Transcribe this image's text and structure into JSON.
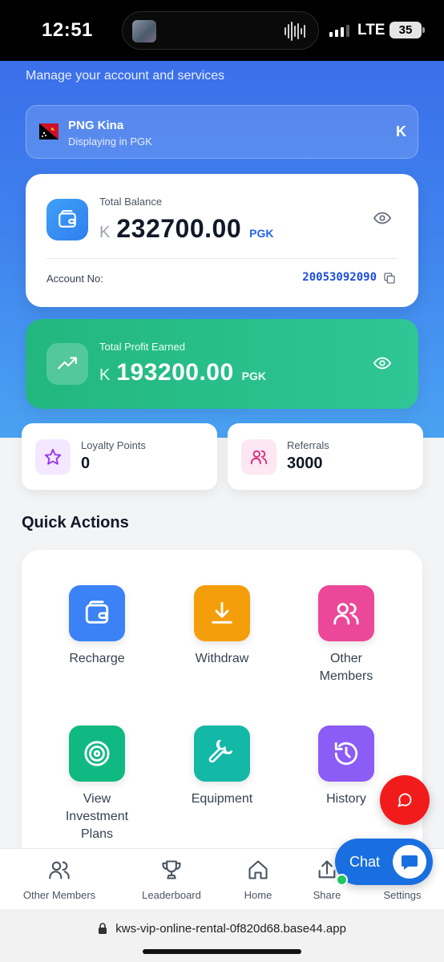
{
  "status": {
    "time": "12:51",
    "network": "LTE",
    "battery": "35"
  },
  "header": {
    "subtitle": "Manage your account and services"
  },
  "currency": {
    "name": "PNG Kina",
    "sub": "Displaying in PGK",
    "symbol": "K"
  },
  "balance": {
    "label": "Total Balance",
    "symbol": "K",
    "amount": "232700.00",
    "currency": "PGK",
    "account_label": "Account No:",
    "account_no": "20053092090"
  },
  "profit": {
    "label": "Total Profit Earned",
    "symbol": "K",
    "amount": "193200.00",
    "currency": "PGK"
  },
  "stats": {
    "loyalty": {
      "label": "Loyalty Points",
      "value": "0"
    },
    "referrals": {
      "label": "Referrals",
      "value": "3000"
    }
  },
  "quick_actions": {
    "title": "Quick Actions",
    "items": [
      {
        "label": "Recharge",
        "icon": "wallet-icon",
        "color": "#3b82f6"
      },
      {
        "label": "Withdraw",
        "icon": "download-icon",
        "color": "#f59e0b"
      },
      {
        "label": "Other Members",
        "icon": "users-icon",
        "color": "#ec4899"
      },
      {
        "label": "View Investment Plans",
        "icon": "target-icon",
        "color": "#10b981"
      },
      {
        "label": "Equipment",
        "icon": "wrench-icon",
        "color": "#14b8a6"
      },
      {
        "label": "History",
        "icon": "history-icon",
        "color": "#8b5cf6"
      }
    ]
  },
  "nav": {
    "items": [
      {
        "label": "Other Members",
        "icon": "users-icon"
      },
      {
        "label": "Leaderboard",
        "icon": "trophy-icon"
      },
      {
        "label": "Home",
        "icon": "home-icon"
      },
      {
        "label": "Share",
        "icon": "share-icon"
      },
      {
        "label": "Settings",
        "icon": "gear-icon"
      }
    ]
  },
  "chat": {
    "label": "Chat"
  },
  "browser": {
    "url": "kws-vip-online-rental-0f820d68.base44.app"
  },
  "colors": {
    "hero": "#3b82f6",
    "profit": "#22c55e",
    "accent_text": "#1d4ed8",
    "fab": "#f21b1b"
  }
}
